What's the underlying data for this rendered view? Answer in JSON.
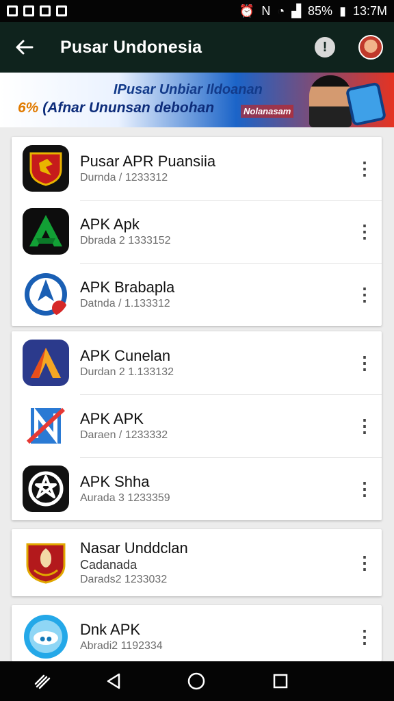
{
  "status_bar": {
    "battery": "85%",
    "time": "13:7M"
  },
  "app_bar": {
    "title": "Pusar Undonesia"
  },
  "banner": {
    "line1": "IPusar Unbiar Ildoanan",
    "line2_accent": "6%",
    "line2": "(Afnar Ununsan debohan",
    "cta": "Nolanasam"
  },
  "cards": [
    {
      "items": [
        {
          "title": "Pusar APR Puansiia",
          "subtitle": "Durnda / 1233312",
          "icon": "shield-emblem-icon"
        },
        {
          "title": "APK Apk",
          "subtitle": "Dbrada 2 1333152",
          "icon": "green-a-logo-icon"
        },
        {
          "title": "APK Brabapla",
          "subtitle": "Datnda / 1.133312",
          "icon": "blue-plane-logo-icon"
        }
      ]
    },
    {
      "items": [
        {
          "title": "APK Cunelan",
          "subtitle": "Durdan 2 1.133132",
          "icon": "triangle-a-logo-icon"
        },
        {
          "title": "APK APK",
          "subtitle": "Daraen / 1233332",
          "icon": "n-logo-icon"
        },
        {
          "title": "APK Shha",
          "subtitle": "Aurada 3 1233359",
          "icon": "star-circle-logo-icon"
        }
      ]
    },
    {
      "items": [
        {
          "title": "Nasar Unddclan",
          "subtitle2": "Cadanada",
          "subtitle": "Darads2 1233032",
          "icon": "crest-logo-icon"
        }
      ]
    },
    {
      "items": [
        {
          "title": "Dnk APK",
          "subtitle": "Abradi2 1192334",
          "icon": "cyan-bubble-logo-icon"
        }
      ]
    }
  ],
  "icon_colors": {
    "shield": "#c61b1b",
    "green": "#12a035",
    "blue": "#1a5fb4",
    "triangle": "#2b3a8c",
    "n_logo": "#2a7ad4",
    "black": "#111111",
    "crest": "#b3191c",
    "cyan": "#24a8e8"
  }
}
